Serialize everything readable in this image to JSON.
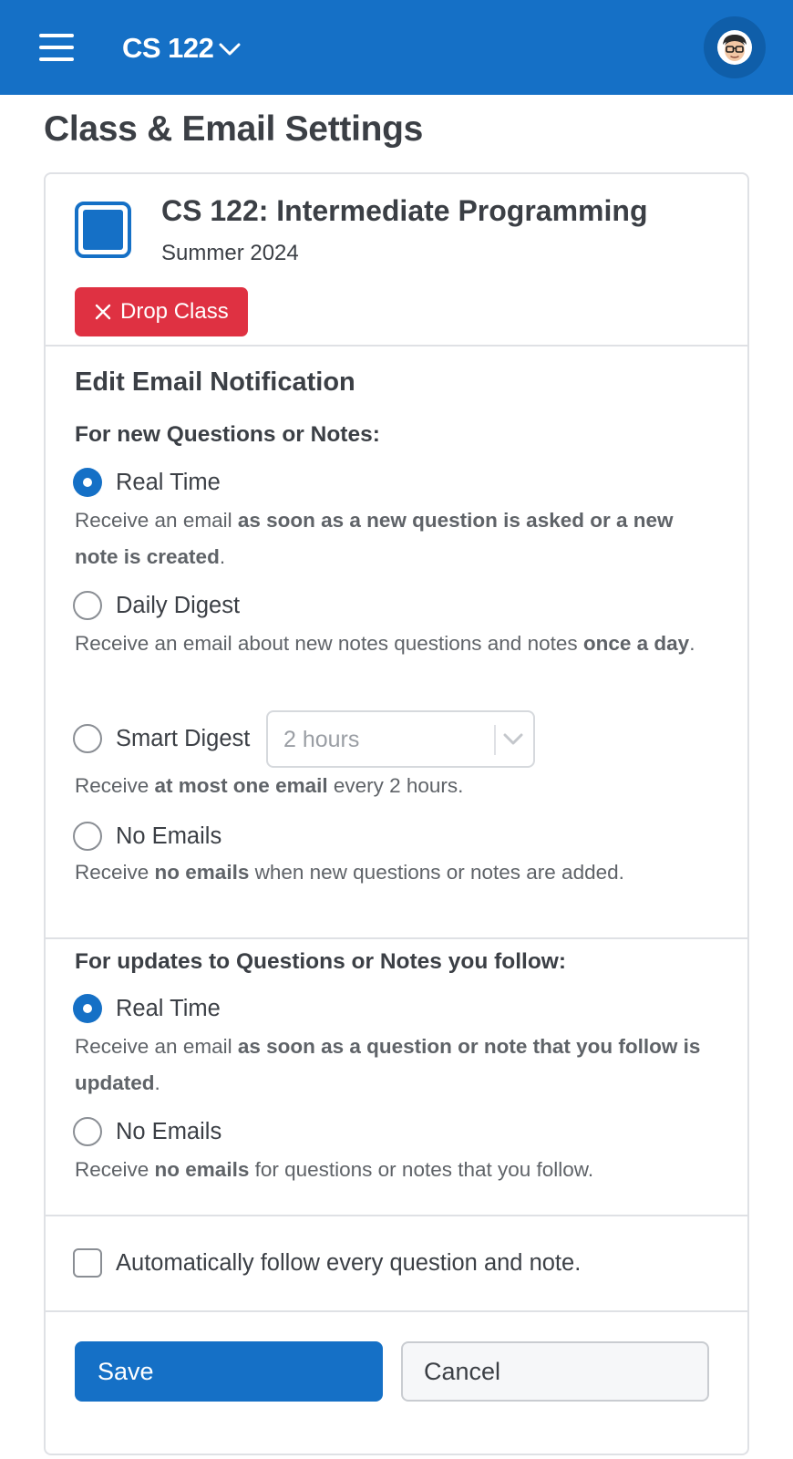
{
  "header": {
    "course_switcher": "CS 122",
    "icons": {
      "menu": "hamburger-menu-icon",
      "dropdown": "chevron-down-icon",
      "avatar": "user-avatar"
    }
  },
  "page": {
    "title": "Class & Email Settings"
  },
  "course": {
    "name": "CS 122: Intermediate Programming",
    "term": "Summer 2024",
    "drop_label": "Drop Class",
    "accent": "#1570c6"
  },
  "email": {
    "title": "Edit Email Notification",
    "new_posts": {
      "heading": "For new Questions or Notes:",
      "selected": "Real Time",
      "options": [
        {
          "label": "Real Time",
          "desc_pre": "Receive an email ",
          "desc_bold": "as soon as a new question is asked or a new note is created",
          "desc_post": "."
        },
        {
          "label": "Daily Digest",
          "desc_pre": "Receive an email about new notes questions and notes ",
          "desc_bold": "once a day",
          "desc_post": "."
        },
        {
          "label": "Smart Digest",
          "desc_pre": "Receive ",
          "desc_bold": "at most one email",
          "desc_post": " every 2 hours."
        },
        {
          "label": "No Emails",
          "desc_pre": "Receive ",
          "desc_bold": "no emails",
          "desc_post": " when new questions or notes are added."
        }
      ],
      "smart_digest_interval": "2 hours"
    },
    "followed_posts": {
      "heading": "For updates to Questions or Notes you follow:",
      "selected": "Real Time",
      "options": [
        {
          "label": "Real Time",
          "desc_pre": "Receive an email ",
          "desc_bold": "as soon as a question or note that you follow is updated",
          "desc_post": "."
        },
        {
          "label": "No Emails",
          "desc_pre": "Receive ",
          "desc_bold": "no emails",
          "desc_post": " for questions or notes that you follow."
        }
      ]
    },
    "auto_follow": {
      "label": "Automatically follow every question and note.",
      "checked": false
    }
  },
  "actions": {
    "save": "Save",
    "cancel": "Cancel"
  },
  "colors": {
    "header": "#1570c6",
    "danger": "#df3142",
    "primary": "#1570c6"
  }
}
